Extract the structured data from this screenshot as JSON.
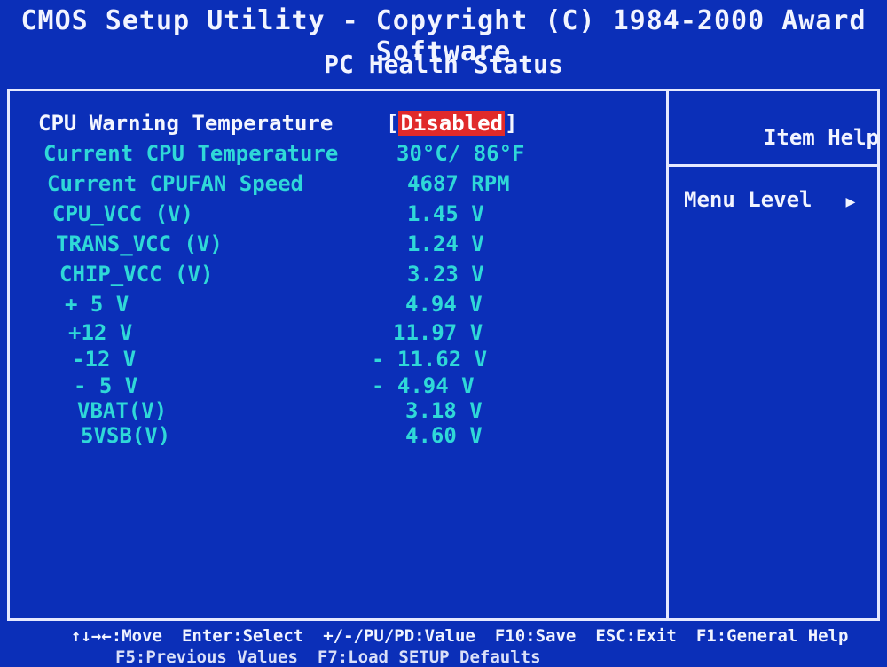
{
  "header": {
    "title": "CMOS Setup Utility - Copyright (C) 1984-2000 Award Software",
    "subtitle": "PC Health Status"
  },
  "settings": [
    {
      "label": "CPU Warning Temperature",
      "value": "Disabled",
      "bracketed": true
    },
    {
      "label": "Current CPU Temperature",
      "value": "30°C/ 86°F"
    },
    {
      "label": "Current CPUFAN Speed",
      "value": "4687 RPM"
    },
    {
      "label": "CPU_VCC (V)",
      "value": "1.45 V"
    },
    {
      "label": "TRANS_VCC (V)",
      "value": "1.24 V"
    },
    {
      "label": "CHIP_VCC (V)",
      "value": "3.23 V"
    },
    {
      "label": "+ 5 V",
      "value": "4.94 V"
    },
    {
      "label": "+12 V",
      "value": "11.97 V"
    },
    {
      "label": "-12 V",
      "value": "- 11.62 V"
    },
    {
      "label": "- 5 V",
      "value": "- 4.94 V"
    },
    {
      "label": "VBAT(V)",
      "value": "3.18 V"
    },
    {
      "label": "5VSB(V)",
      "value": "4.60 V"
    }
  ],
  "help": {
    "title": "Item Help",
    "menu_level_label": "Menu Level",
    "menu_level_arrow": "▶"
  },
  "footer": {
    "move": "↑↓→←:Move",
    "enter": "Enter:Select",
    "value": "+/-/PU/PD:Value",
    "save": "F10:Save",
    "exit": "ESC:Exit",
    "general_help": "F1:General Help",
    "previous": "F5:Previous Values",
    "defaults": "F7:Load SETUP Defaults"
  },
  "colors": {
    "background": "#0b2fb8",
    "item_text": "#2fd8d8",
    "active_text": "#f4f6ff",
    "selection": "#e02a2a"
  }
}
